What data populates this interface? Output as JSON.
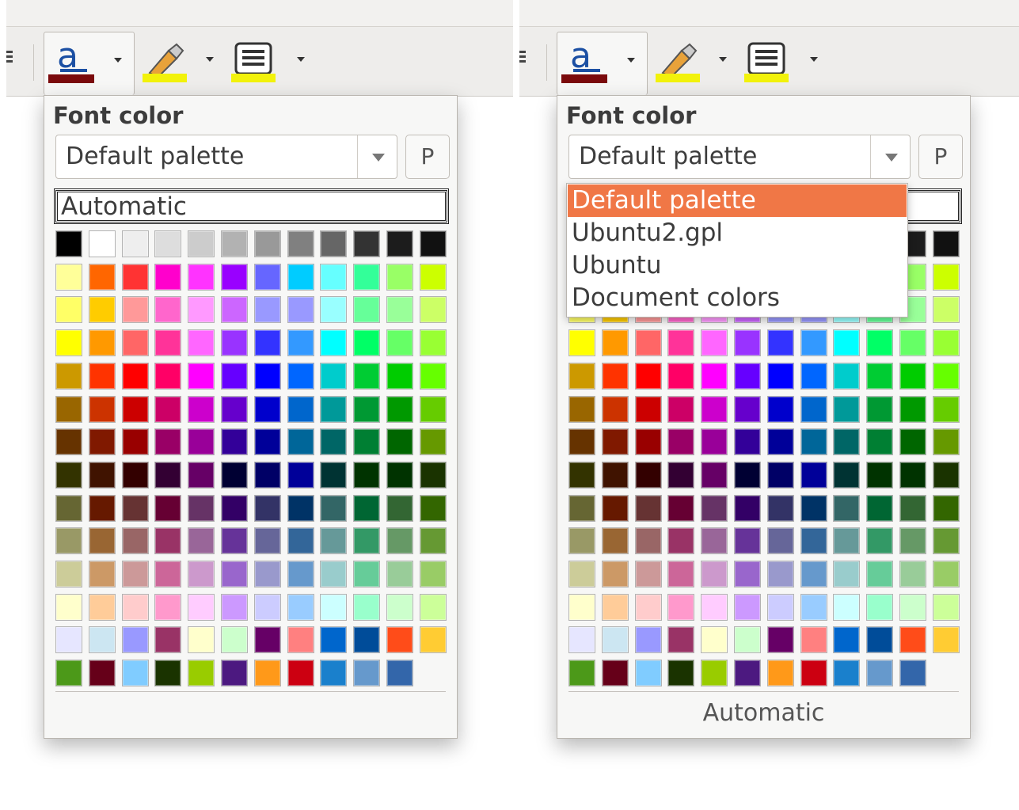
{
  "popup_title": "Font color",
  "palette_selected": "Default palette",
  "palette_button_label": "P",
  "automatic_label": "Automatic",
  "palette_options": [
    {
      "label": "Default palette",
      "selected": true
    },
    {
      "label": "Ubuntu2.gpl",
      "selected": false
    },
    {
      "label": "Ubuntu",
      "selected": false
    },
    {
      "label": "Document colors",
      "selected": false
    }
  ],
  "toolbar": {
    "font_color_icon": "font-color-icon",
    "highlight_icon": "highlighting-icon",
    "background_icon": "paragraph-background-icon",
    "font_color_value": "#7b0a0c",
    "highlight_value": "#f2f20a",
    "background_value": "#f2f20a"
  },
  "swatches": [
    [
      "#000000",
      "#ffffff",
      "#eeeeee",
      "#dddddd",
      "#cccccc",
      "#b2b2b2",
      "#999999",
      "#808080",
      "#666666",
      "#333333",
      "#1c1c1c",
      "#111111"
    ],
    [
      "#ffff99",
      "#ff6600",
      "#ff3333",
      "#ff00cc",
      "#ff33ff",
      "#9900ff",
      "#6666ff",
      "#00ccff",
      "#66ffff",
      "#33ff99",
      "#99ff66",
      "#ccff00"
    ],
    [
      "#ffff66",
      "#ffcc00",
      "#ff9999",
      "#ff66cc",
      "#ff99ff",
      "#cc66ff",
      "#9999ff",
      "#9999ff",
      "#99ffff",
      "#66ff99",
      "#99ff99",
      "#ccff66"
    ],
    [
      "#ffff00",
      "#ff9900",
      "#ff6666",
      "#ff3399",
      "#ff66ff",
      "#9933ff",
      "#3333ff",
      "#3399ff",
      "#00ffff",
      "#00ff66",
      "#66ff66",
      "#99ff33"
    ],
    [
      "#cc9900",
      "#ff3300",
      "#ff0000",
      "#ff0066",
      "#ff00ff",
      "#6600ff",
      "#0000ff",
      "#0066ff",
      "#00cccc",
      "#00cc33",
      "#00cc00",
      "#66ff00"
    ],
    [
      "#996600",
      "#cc3300",
      "#cc0000",
      "#cc0066",
      "#cc00cc",
      "#6600cc",
      "#0000cc",
      "#0066cc",
      "#009999",
      "#009933",
      "#009900",
      "#66cc00"
    ],
    [
      "#663300",
      "#801900",
      "#990000",
      "#990066",
      "#990099",
      "#330099",
      "#000099",
      "#006699",
      "#006666",
      "#007f33",
      "#006600",
      "#669900"
    ],
    [
      "#333300",
      "#401300",
      "#330000",
      "#330033",
      "#660066",
      "#000033",
      "#000066",
      "#000099",
      "#003333",
      "#003300",
      "#003300",
      "#1a3300"
    ],
    [
      "#666633",
      "#661900",
      "#663333",
      "#660033",
      "#663366",
      "#330066",
      "#333366",
      "#003366",
      "#336666",
      "#006633",
      "#336633",
      "#336600"
    ],
    [
      "#999966",
      "#996633",
      "#996666",
      "#993366",
      "#996699",
      "#663399",
      "#666699",
      "#336699",
      "#669999",
      "#339966",
      "#669966",
      "#669933"
    ],
    [
      "#cccc99",
      "#cc9966",
      "#cc9999",
      "#cc6699",
      "#cc99cc",
      "#9966cc",
      "#9999cc",
      "#6699cc",
      "#99cccc",
      "#66cc99",
      "#99cc99",
      "#99cc66"
    ],
    [
      "#ffffcc",
      "#ffcc99",
      "#ffcccc",
      "#ff99cc",
      "#ffccff",
      "#cc99ff",
      "#ccccff",
      "#99ccff",
      "#ccffff",
      "#99ffcc",
      "#ccffcc",
      "#ccff99"
    ],
    [
      "#e6e6ff",
      "#cce6f2",
      "#9999ff",
      "#993366",
      "#ffffcc",
      "#ccffcc",
      "#660066",
      "#ff8080",
      "#0066cc",
      "#004c99",
      "#ff4c19",
      "#ffcc33"
    ],
    [
      "#4c9919",
      "#660019",
      "#80ccff",
      "#1a3300",
      "#99cc00",
      "#4c1980",
      "#ff9919",
      "#cc0011",
      "#1a80cc",
      "#6699cc",
      "#3366aa"
    ]
  ]
}
